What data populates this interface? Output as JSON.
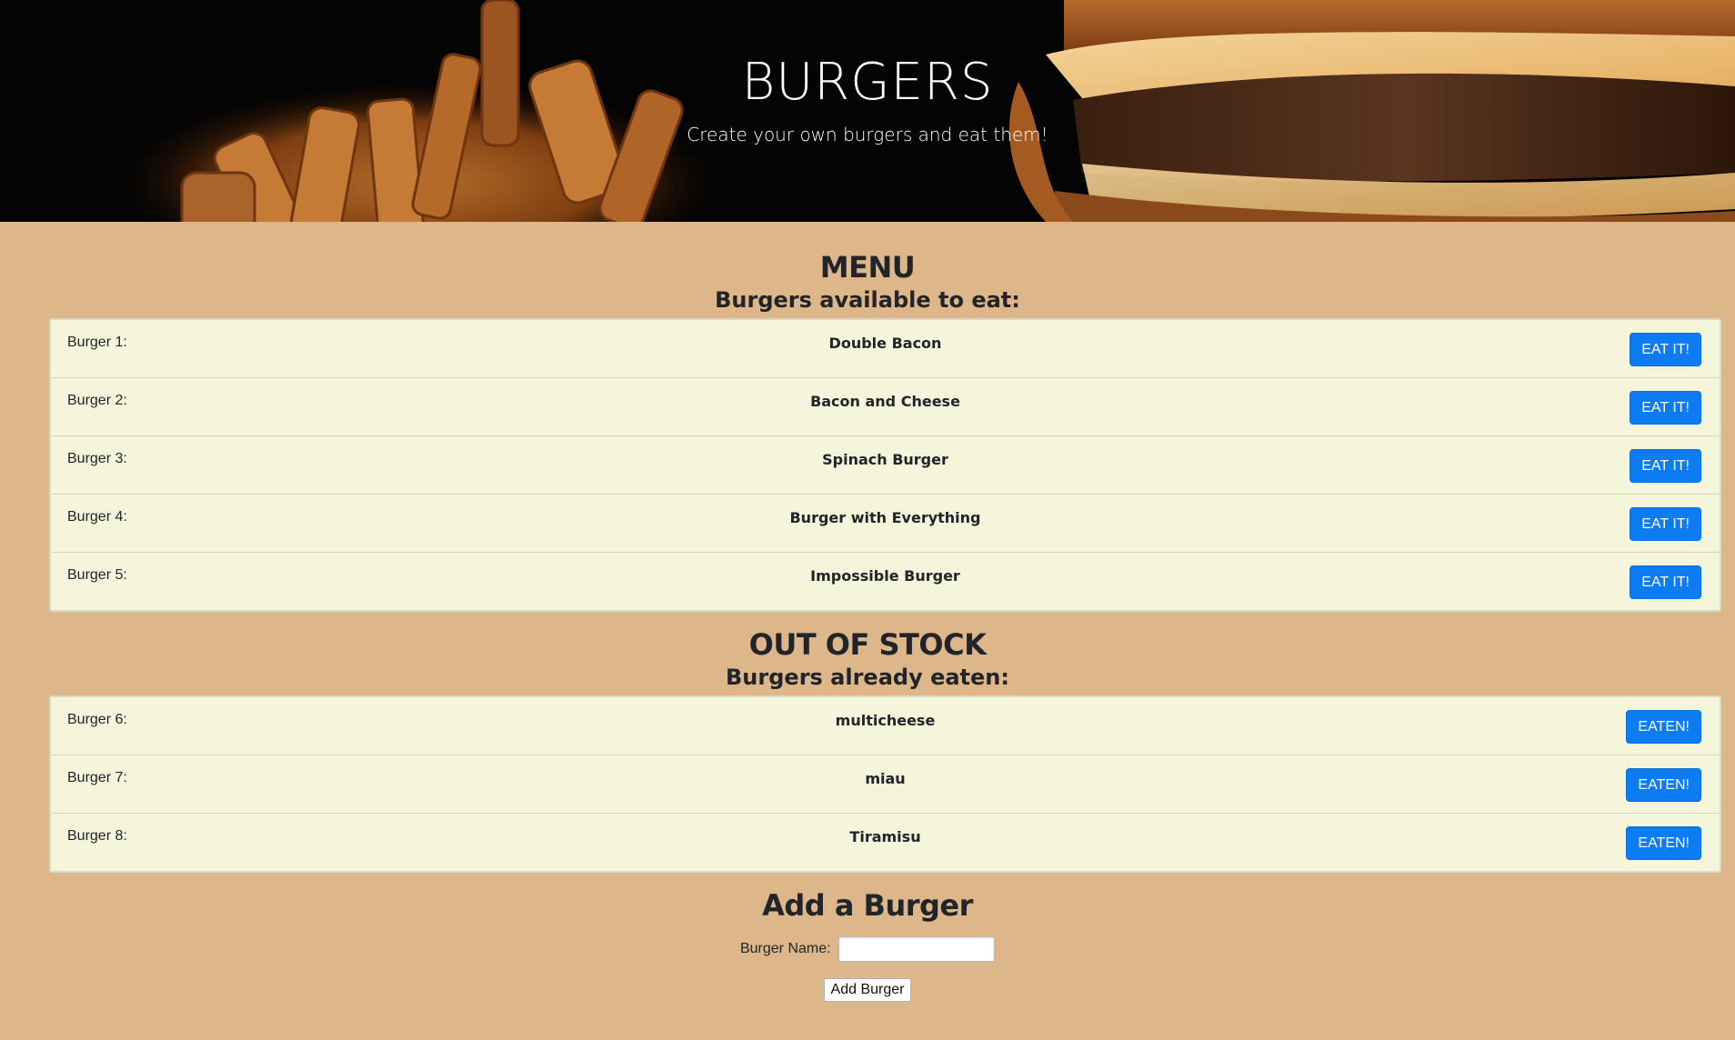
{
  "hero": {
    "title": "BURGERS",
    "subtitle": "Create your own burgers and eat them!"
  },
  "menu": {
    "title": "MENU",
    "subtitle": "Burgers available to eat:",
    "button_label": "EAT IT!",
    "items": [
      {
        "label": "Burger 1:",
        "name": "Double Bacon"
      },
      {
        "label": "Burger 2:",
        "name": "Bacon and Cheese"
      },
      {
        "label": "Burger 3:",
        "name": "Spinach Burger"
      },
      {
        "label": "Burger 4:",
        "name": "Burger with Everything"
      },
      {
        "label": "Burger 5:",
        "name": "Impossible Burger"
      }
    ]
  },
  "out_of_stock": {
    "title": "OUT OF STOCK",
    "subtitle": "Burgers already eaten:",
    "button_label": "EATEN!",
    "items": [
      {
        "label": "Burger 6:",
        "name": "multicheese"
      },
      {
        "label": "Burger 7:",
        "name": "miau"
      },
      {
        "label": "Burger 8:",
        "name": "Tiramisu"
      }
    ]
  },
  "add_form": {
    "title": "Add a Burger",
    "field_label": "Burger Name:",
    "field_value": "",
    "submit_label": "Add Burger"
  },
  "colors": {
    "page_background": "#ddb68a",
    "list_background": "#f5f5dc",
    "button_primary": "#0d7bf2"
  }
}
